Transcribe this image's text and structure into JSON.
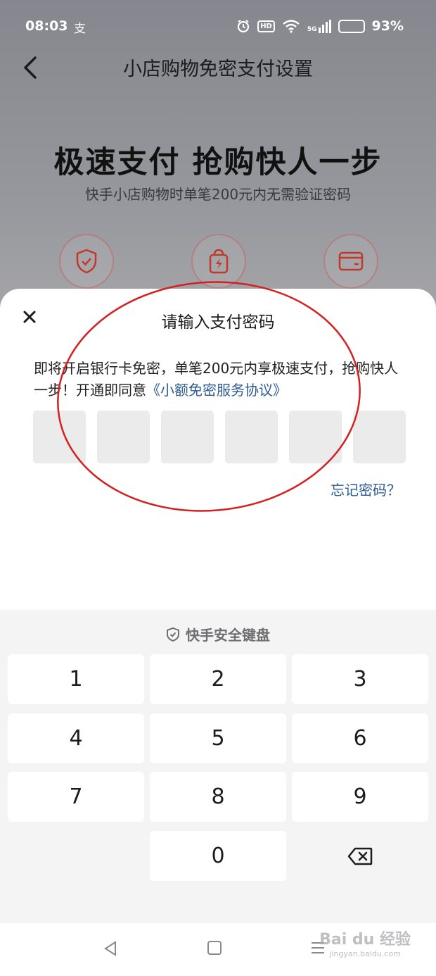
{
  "status_bar": {
    "time": "08:03",
    "app_icon": "alipay-glyph",
    "network": "5G",
    "hd": "HD",
    "battery": "93%"
  },
  "nav": {
    "title": "小店购物免密支付设置"
  },
  "hero": {
    "title": "极速支付 抢购快人一步",
    "subtitle": "快手小店购物时单笔200元内无需验证密码"
  },
  "features": [
    {
      "icon": "shield-check-icon"
    },
    {
      "icon": "shopping-bag-lightning-icon"
    },
    {
      "icon": "card-icon"
    }
  ],
  "sheet": {
    "title": "请输入支付密码",
    "desc": "即将开启银行卡免密，单笔200元内享极速支付，抢购快人一步！开通即同意",
    "agreement_link": "《小额免密服务协议》",
    "pin_length": 6,
    "forgot": "忘记密码？"
  },
  "keyboard": {
    "title": "快手安全键盘",
    "keys": [
      "1",
      "2",
      "3",
      "4",
      "5",
      "6",
      "7",
      "8",
      "9",
      "0"
    ]
  },
  "watermark": {
    "text": "Bai du 经验",
    "url": "jingyan.baidu.com"
  },
  "colors": {
    "link": "#2f5b93",
    "accent_red": "#c0392b",
    "annotation_red": "#d42020"
  }
}
